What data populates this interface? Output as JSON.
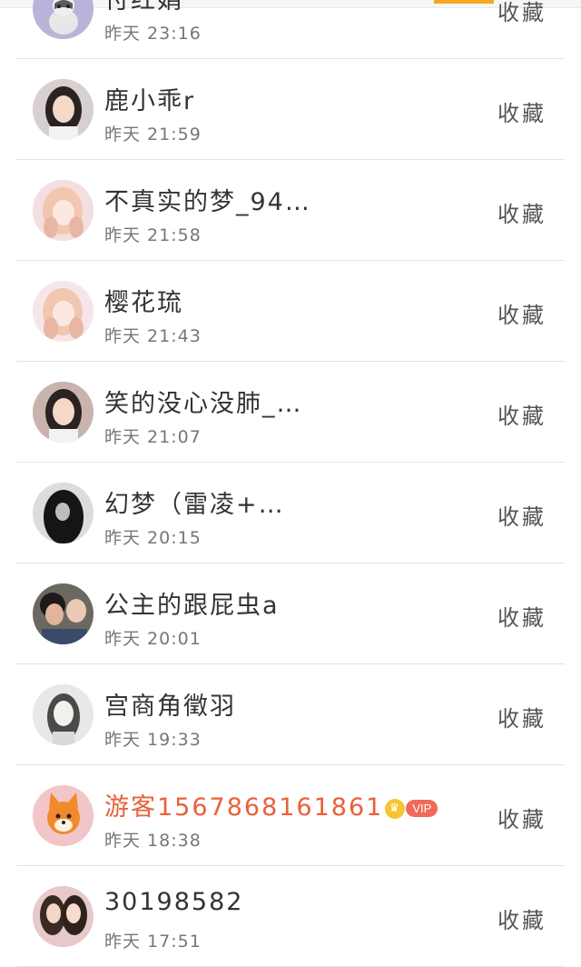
{
  "favorite_label": "收藏",
  "rows": [
    {
      "name": "付红娟",
      "time": "昨天 23:16",
      "avatar": "cat-avatar",
      "bg": "#b8b3d9"
    },
    {
      "name": "鹿小乖r",
      "time": "昨天 21:59",
      "avatar": "girl-photo-avatar",
      "bg": "#d8cfd0"
    },
    {
      "name": "不真实的梦_94…",
      "time": "昨天 21:58",
      "avatar": "anime-girl-avatar",
      "bg": "#f3dfe0"
    },
    {
      "name": "樱花琉",
      "time": "昨天 21:43",
      "avatar": "anime-girl-avatar",
      "bg": "#f6e6ea"
    },
    {
      "name": "笑的没心没肺_…",
      "time": "昨天 21:07",
      "avatar": "girl-photo-avatar",
      "bg": "#c9b4ad"
    },
    {
      "name": "幻梦（雷凌+…",
      "time": "昨天 20:15",
      "avatar": "dark-photo-avatar",
      "bg": "#3a3a3a"
    },
    {
      "name": "公主的跟屁虫a",
      "time": "昨天 20:01",
      "avatar": "couple-photo-avatar",
      "bg": "#6b6864"
    },
    {
      "name": "宫商角徵羽",
      "time": "昨天 19:33",
      "avatar": "sketch-girl-avatar",
      "bg": "#e8e8e6"
    },
    {
      "name": "游客15678681618​61",
      "time": "昨天 18:38",
      "avatar": "fox-cartoon-avatar",
      "bg": "#f2c6c8",
      "vip": true,
      "vip_label": "VIP"
    },
    {
      "name": "30198582",
      "time": "昨天 17:51",
      "avatar": "two-girls-photo-avatar",
      "bg": "#e8c9c9"
    }
  ]
}
